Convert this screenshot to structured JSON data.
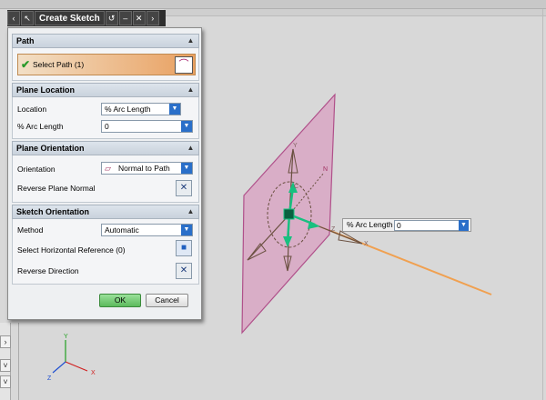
{
  "dialog": {
    "title": "Create Sketch",
    "titlebar_icons": [
      "chevron-left-icon",
      "arrow-cursor-icon",
      "reset-icon",
      "minimize-icon",
      "close-icon",
      "chevron-right-icon"
    ],
    "path": {
      "header": "Path",
      "select_label": "Select Path (1)"
    },
    "plane_location": {
      "header": "Plane Location",
      "location_label": "Location",
      "location_value": "% Arc Length",
      "arc_label": "% Arc Length",
      "arc_value": "0"
    },
    "plane_orientation": {
      "header": "Plane Orientation",
      "orientation_label": "Orientation",
      "orientation_value": "Normal to Path",
      "reverse_label": "Reverse Plane Normal"
    },
    "sketch_orientation": {
      "header": "Sketch Orientation",
      "method_label": "Method",
      "method_value": "Automatic",
      "horiz_label": "Select Horizontal Reference (0)",
      "reverse_dir_label": "Reverse Direction"
    },
    "ok_label": "OK",
    "cancel_label": "Cancel"
  },
  "floating_field": {
    "label": "% Arc Length",
    "value": "0"
  },
  "scene": {
    "axis_labels": {
      "x": "X",
      "y": "Y",
      "z": "Z",
      "n": "N",
      "c": "C"
    },
    "triad_labels": {
      "x": "X",
      "y": "Y",
      "z": "Z"
    }
  },
  "colors": {
    "plane": "#d88ab8",
    "path": "#f0a050",
    "handle": "#18c080",
    "ok": "#5cba5c"
  }
}
